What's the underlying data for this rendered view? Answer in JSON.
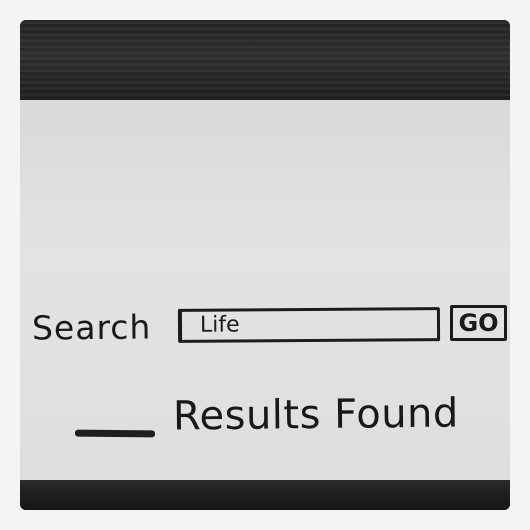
{
  "search": {
    "label": "Search",
    "value": "Life",
    "button_label": "GO"
  },
  "results": {
    "count": "",
    "label": "Results Found"
  }
}
